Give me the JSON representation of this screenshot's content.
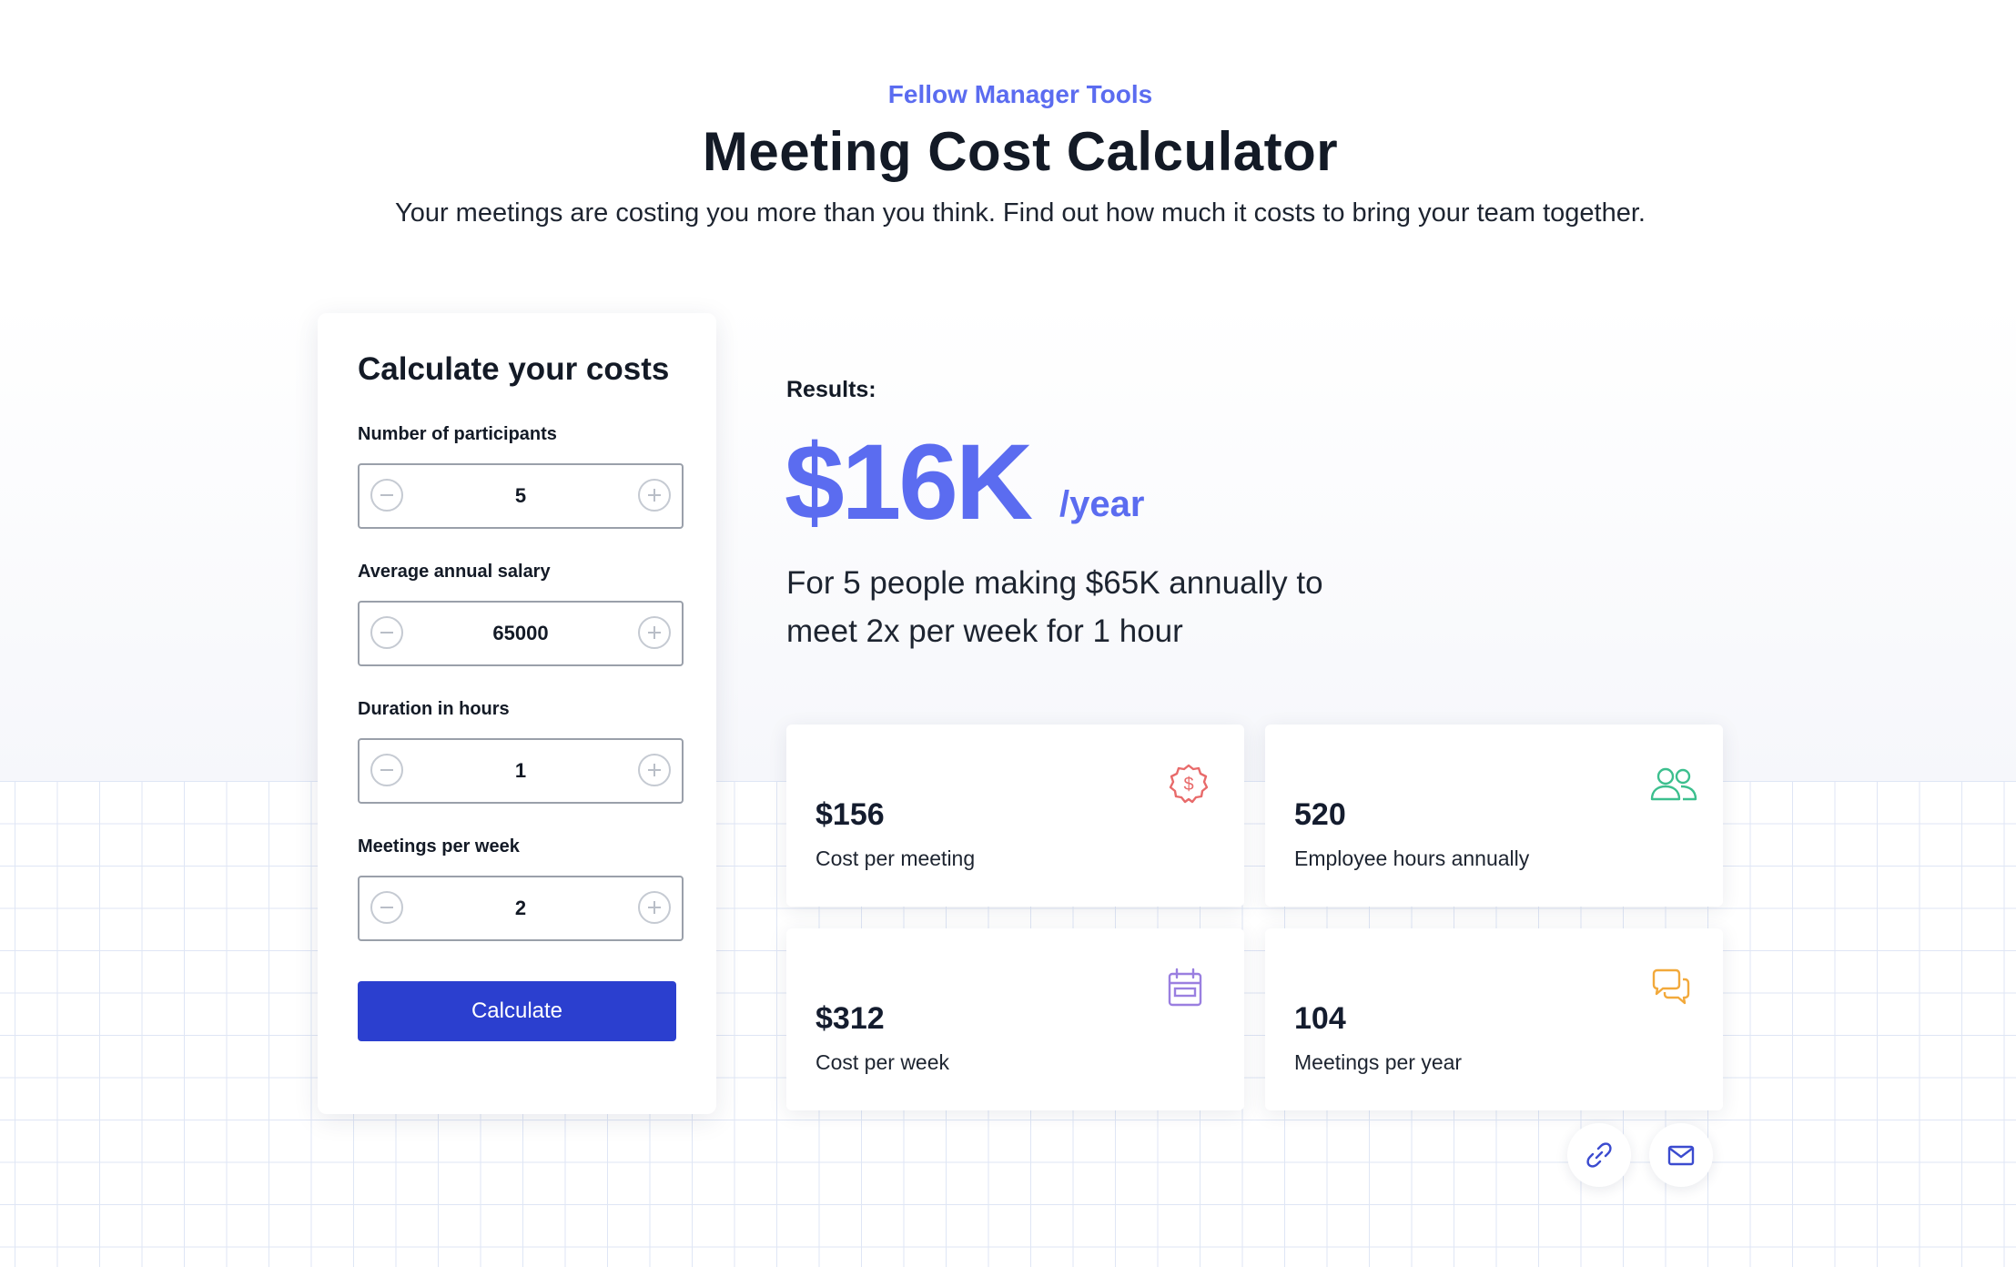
{
  "header": {
    "eyebrow": "Fellow Manager Tools",
    "title": "Meeting Cost Calculator",
    "subtitle": "Your meetings are costing you more than you think. Find out how much it costs to bring your team together."
  },
  "calculator": {
    "title": "Calculate your costs",
    "fields": [
      {
        "label": "Number of participants",
        "value": "5"
      },
      {
        "label": "Average annual salary",
        "value": "65000"
      },
      {
        "label": "Duration in hours",
        "value": "1"
      },
      {
        "label": "Meetings per week",
        "value": "2"
      }
    ],
    "button_label": "Calculate"
  },
  "results": {
    "label": "Results:",
    "big_value": "$16K",
    "big_unit": "/year",
    "description_line1": "For 5 people making $65K annually to",
    "description_line2": "meet 2x per week for 1 hour",
    "stats": [
      {
        "value": "$156",
        "label": "Cost per meeting",
        "icon": "dollar-badge-icon",
        "color": "#e86a6a"
      },
      {
        "value": "520",
        "label": "Employee hours annually",
        "icon": "users-icon",
        "color": "#3cbf8e"
      },
      {
        "value": "$312",
        "label": "Cost per week",
        "icon": "calendar-icon",
        "color": "#9a7fe0"
      },
      {
        "value": "104",
        "label": "Meetings per year",
        "icon": "chat-bubbles-icon",
        "color": "#f2a93b"
      }
    ]
  },
  "share": {
    "link_icon": "link-icon",
    "email_icon": "mail-icon",
    "icon_color": "#3b4bcf"
  },
  "colors": {
    "accent": "#5b6cf0",
    "button": "#2b3fcf",
    "text": "#131a26"
  }
}
